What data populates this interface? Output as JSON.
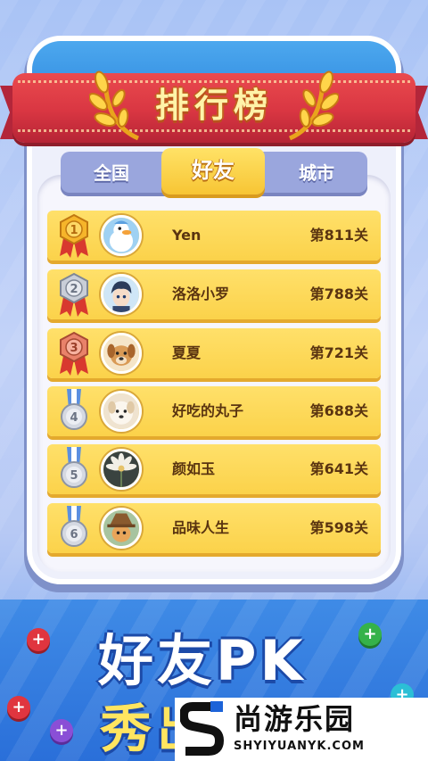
{
  "title": "排行榜",
  "tabs": [
    {
      "label": "全国",
      "active": false
    },
    {
      "label": "好友",
      "active": true
    },
    {
      "label": "城市",
      "active": false
    }
  ],
  "leaderboard": [
    {
      "rank": "1",
      "name": "Yen",
      "level": "第811关",
      "medal": "gold-medal",
      "avatar": "duck-avatar"
    },
    {
      "rank": "2",
      "name": "洛洛小罗",
      "level": "第788关",
      "medal": "silver-medal",
      "avatar": "anime-boy-avatar"
    },
    {
      "rank": "3",
      "name": "夏夏",
      "level": "第721关",
      "medal": "bronze-medal",
      "avatar": "puppy-avatar"
    },
    {
      "rank": "4",
      "name": "好吃的丸子",
      "level": "第688关",
      "medal": "grey-medal",
      "avatar": "fluffy-dog-avatar"
    },
    {
      "rank": "5",
      "name": "颜如玉",
      "level": "第641关",
      "medal": "grey-medal",
      "avatar": "flower-avatar"
    },
    {
      "rank": "6",
      "name": "品味人生",
      "level": "第598关",
      "medal": "grey-medal",
      "avatar": "cat-hat-avatar"
    }
  ],
  "banner": {
    "line1": "好友PK",
    "line2": "秀出实力"
  },
  "watermark": {
    "name_cn": "尚游乐园",
    "name_en": "SHYIYUANYK.COM"
  },
  "colors": {
    "ribbon": "#d93642",
    "row": "#fbd24a",
    "tab_active": "#f7c534",
    "tab_inactive": "#9aa6dd",
    "banner": "#2a6fd9"
  }
}
